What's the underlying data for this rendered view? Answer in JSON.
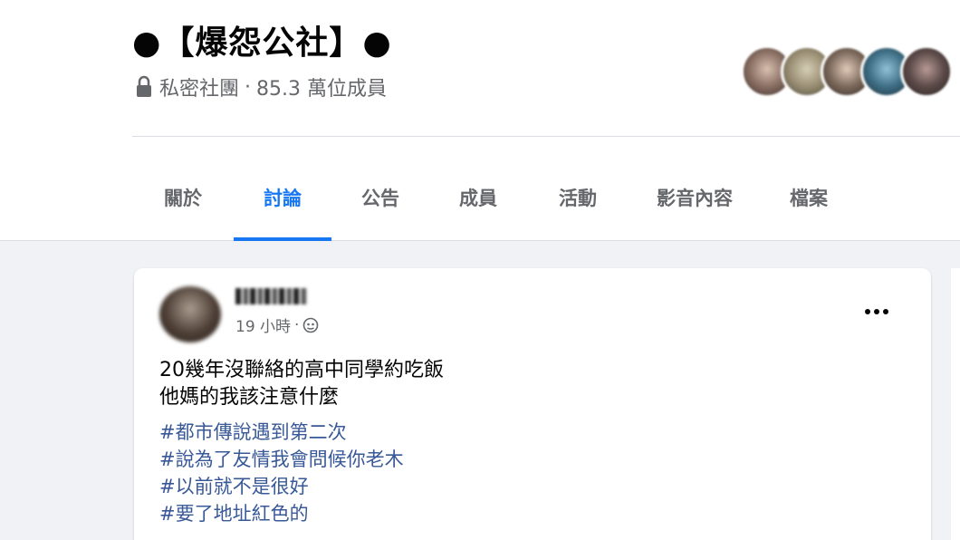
{
  "group": {
    "title": "●【爆怨公社】●",
    "privacy": "私密社團",
    "separator": "·",
    "members": "85.3 萬位成員",
    "lock_icon": "lock-icon"
  },
  "member_avatars": [
    {
      "color": "#8a6f63"
    },
    {
      "color": "#9a8f74"
    },
    {
      "color": "#7d6a5c"
    },
    {
      "color": "#3f6f86"
    },
    {
      "color": "#5b4a48"
    }
  ],
  "tabs": [
    {
      "label": "關於",
      "active": false
    },
    {
      "label": "討論",
      "active": true
    },
    {
      "label": "公告",
      "active": false
    },
    {
      "label": "成員",
      "active": false
    },
    {
      "label": "活動",
      "active": false
    },
    {
      "label": "影音內容",
      "active": false
    },
    {
      "label": "檔案",
      "active": false
    }
  ],
  "post": {
    "time": "19 小時",
    "separator": "·",
    "audience_icon": "globe-icon",
    "more_icon": "more-options-icon",
    "body_lines": [
      "20幾年沒聯絡的高中同學約吃飯",
      "他媽的我該注意什麼"
    ],
    "hashtags": [
      "#都市傳說遇到第二次",
      "#說為了友情我會問候你老木",
      "#以前就不是很好",
      "#要了地址紅色的"
    ]
  },
  "colors": {
    "accent": "#1877f2",
    "hashtag": "#385898",
    "secondary_text": "#65676b",
    "background": "#f0f2f5"
  }
}
